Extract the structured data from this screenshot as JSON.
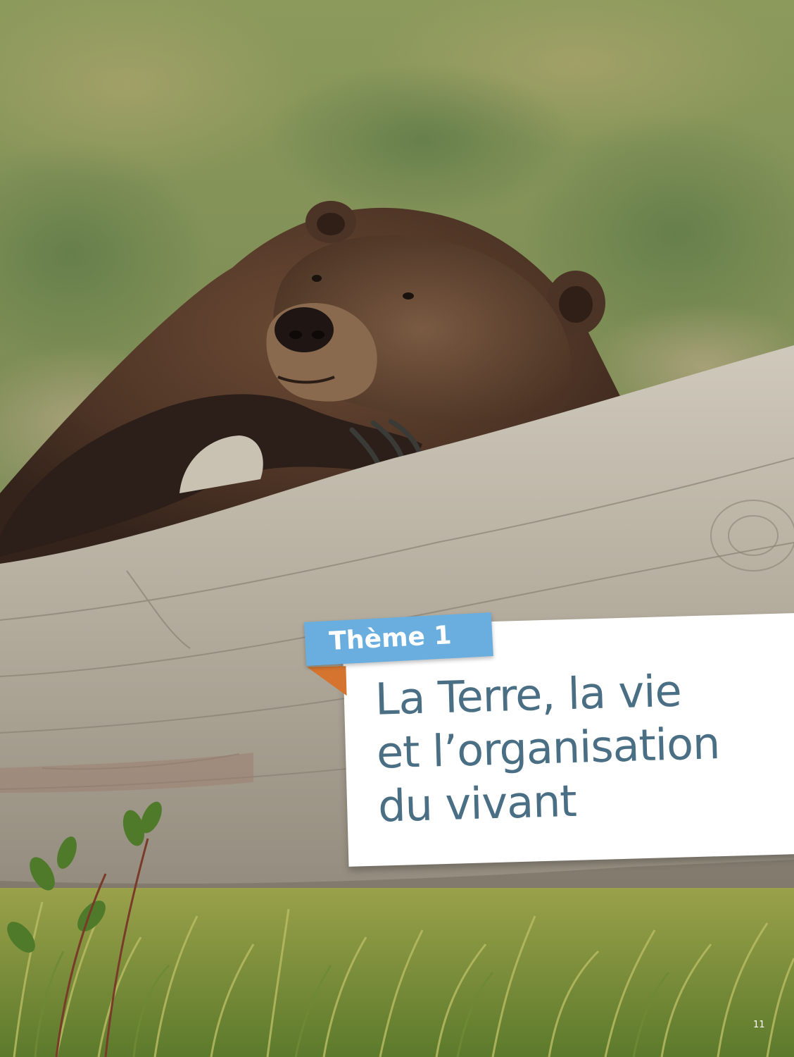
{
  "theme_label": "Thème 1",
  "title": "La Terre, la vie\net l’organisation\ndu vivant",
  "page_number": "11",
  "colors": {
    "theme_tab": "#6aaee0",
    "tab_fold": "#d4742e",
    "title_text": "#4a6f85"
  },
  "photo": {
    "subject": "bear-resting-on-log"
  }
}
